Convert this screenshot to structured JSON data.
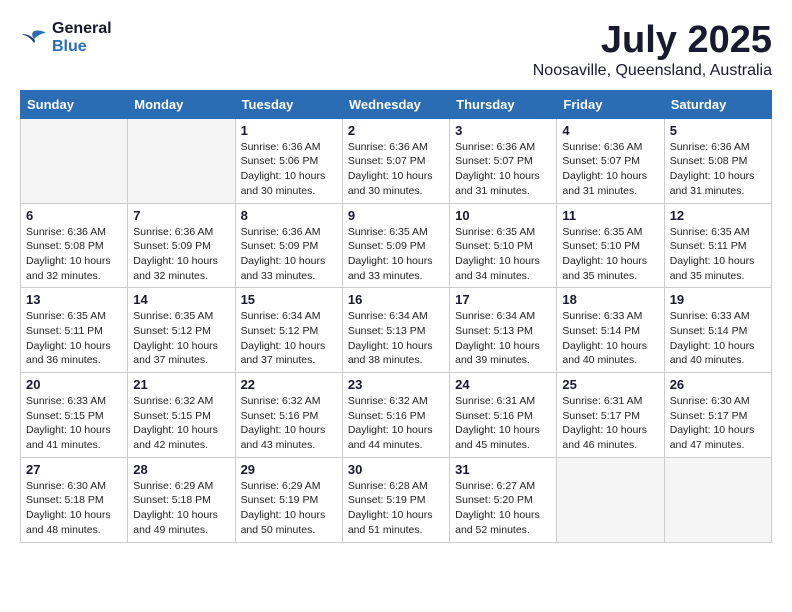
{
  "header": {
    "logo_line1": "General",
    "logo_line2": "Blue",
    "main_title": "July 2025",
    "subtitle": "Noosaville, Queensland, Australia"
  },
  "weekdays": [
    "Sunday",
    "Monday",
    "Tuesday",
    "Wednesday",
    "Thursday",
    "Friday",
    "Saturday"
  ],
  "weeks": [
    [
      {
        "day": "",
        "info": ""
      },
      {
        "day": "",
        "info": ""
      },
      {
        "day": "1",
        "info": "Sunrise: 6:36 AM\nSunset: 5:06 PM\nDaylight: 10 hours\nand 30 minutes."
      },
      {
        "day": "2",
        "info": "Sunrise: 6:36 AM\nSunset: 5:07 PM\nDaylight: 10 hours\nand 30 minutes."
      },
      {
        "day": "3",
        "info": "Sunrise: 6:36 AM\nSunset: 5:07 PM\nDaylight: 10 hours\nand 31 minutes."
      },
      {
        "day": "4",
        "info": "Sunrise: 6:36 AM\nSunset: 5:07 PM\nDaylight: 10 hours\nand 31 minutes."
      },
      {
        "day": "5",
        "info": "Sunrise: 6:36 AM\nSunset: 5:08 PM\nDaylight: 10 hours\nand 31 minutes."
      }
    ],
    [
      {
        "day": "6",
        "info": "Sunrise: 6:36 AM\nSunset: 5:08 PM\nDaylight: 10 hours\nand 32 minutes."
      },
      {
        "day": "7",
        "info": "Sunrise: 6:36 AM\nSunset: 5:09 PM\nDaylight: 10 hours\nand 32 minutes."
      },
      {
        "day": "8",
        "info": "Sunrise: 6:36 AM\nSunset: 5:09 PM\nDaylight: 10 hours\nand 33 minutes."
      },
      {
        "day": "9",
        "info": "Sunrise: 6:35 AM\nSunset: 5:09 PM\nDaylight: 10 hours\nand 33 minutes."
      },
      {
        "day": "10",
        "info": "Sunrise: 6:35 AM\nSunset: 5:10 PM\nDaylight: 10 hours\nand 34 minutes."
      },
      {
        "day": "11",
        "info": "Sunrise: 6:35 AM\nSunset: 5:10 PM\nDaylight: 10 hours\nand 35 minutes."
      },
      {
        "day": "12",
        "info": "Sunrise: 6:35 AM\nSunset: 5:11 PM\nDaylight: 10 hours\nand 35 minutes."
      }
    ],
    [
      {
        "day": "13",
        "info": "Sunrise: 6:35 AM\nSunset: 5:11 PM\nDaylight: 10 hours\nand 36 minutes."
      },
      {
        "day": "14",
        "info": "Sunrise: 6:35 AM\nSunset: 5:12 PM\nDaylight: 10 hours\nand 37 minutes."
      },
      {
        "day": "15",
        "info": "Sunrise: 6:34 AM\nSunset: 5:12 PM\nDaylight: 10 hours\nand 37 minutes."
      },
      {
        "day": "16",
        "info": "Sunrise: 6:34 AM\nSunset: 5:13 PM\nDaylight: 10 hours\nand 38 minutes."
      },
      {
        "day": "17",
        "info": "Sunrise: 6:34 AM\nSunset: 5:13 PM\nDaylight: 10 hours\nand 39 minutes."
      },
      {
        "day": "18",
        "info": "Sunrise: 6:33 AM\nSunset: 5:14 PM\nDaylight: 10 hours\nand 40 minutes."
      },
      {
        "day": "19",
        "info": "Sunrise: 6:33 AM\nSunset: 5:14 PM\nDaylight: 10 hours\nand 40 minutes."
      }
    ],
    [
      {
        "day": "20",
        "info": "Sunrise: 6:33 AM\nSunset: 5:15 PM\nDaylight: 10 hours\nand 41 minutes."
      },
      {
        "day": "21",
        "info": "Sunrise: 6:32 AM\nSunset: 5:15 PM\nDaylight: 10 hours\nand 42 minutes."
      },
      {
        "day": "22",
        "info": "Sunrise: 6:32 AM\nSunset: 5:16 PM\nDaylight: 10 hours\nand 43 minutes."
      },
      {
        "day": "23",
        "info": "Sunrise: 6:32 AM\nSunset: 5:16 PM\nDaylight: 10 hours\nand 44 minutes."
      },
      {
        "day": "24",
        "info": "Sunrise: 6:31 AM\nSunset: 5:16 PM\nDaylight: 10 hours\nand 45 minutes."
      },
      {
        "day": "25",
        "info": "Sunrise: 6:31 AM\nSunset: 5:17 PM\nDaylight: 10 hours\nand 46 minutes."
      },
      {
        "day": "26",
        "info": "Sunrise: 6:30 AM\nSunset: 5:17 PM\nDaylight: 10 hours\nand 47 minutes."
      }
    ],
    [
      {
        "day": "27",
        "info": "Sunrise: 6:30 AM\nSunset: 5:18 PM\nDaylight: 10 hours\nand 48 minutes."
      },
      {
        "day": "28",
        "info": "Sunrise: 6:29 AM\nSunset: 5:18 PM\nDaylight: 10 hours\nand 49 minutes."
      },
      {
        "day": "29",
        "info": "Sunrise: 6:29 AM\nSunset: 5:19 PM\nDaylight: 10 hours\nand 50 minutes."
      },
      {
        "day": "30",
        "info": "Sunrise: 6:28 AM\nSunset: 5:19 PM\nDaylight: 10 hours\nand 51 minutes."
      },
      {
        "day": "31",
        "info": "Sunrise: 6:27 AM\nSunset: 5:20 PM\nDaylight: 10 hours\nand 52 minutes."
      },
      {
        "day": "",
        "info": ""
      },
      {
        "day": "",
        "info": ""
      }
    ]
  ]
}
